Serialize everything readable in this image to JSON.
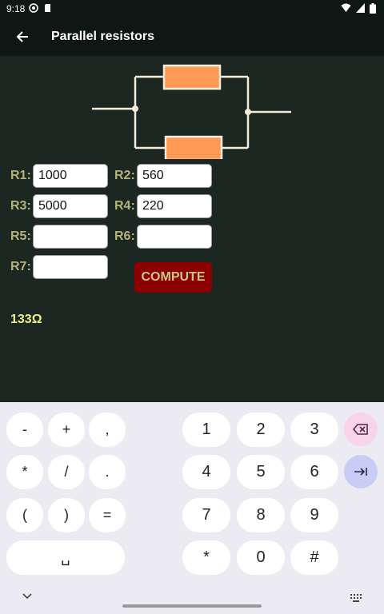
{
  "status": {
    "time": "9:18"
  },
  "app_bar": {
    "title": "Parallel resistors"
  },
  "form": {
    "r1": {
      "label": "R1:",
      "value": "1000"
    },
    "r2": {
      "label": "R2:",
      "value": "560"
    },
    "r3": {
      "label": "R3:",
      "value": "5000"
    },
    "r4": {
      "label": "R4:",
      "value": "220"
    },
    "r5": {
      "label": "R5:",
      "value": ""
    },
    "r6": {
      "label": "R6:",
      "value": ""
    },
    "r7": {
      "label": "R7:",
      "value": ""
    },
    "compute_label": "COMPUTE",
    "result": "133Ω"
  },
  "keyboard": {
    "sym": [
      "-",
      "+",
      ",",
      "*",
      "/",
      ".",
      "(",
      ")",
      "=",
      "␣"
    ],
    "num": [
      "1",
      "2",
      "3",
      "4",
      "5",
      "6",
      "7",
      "8",
      "9",
      "*",
      "0",
      "#"
    ]
  },
  "colors": {
    "background": "#1c2721",
    "bar": "#0e1714",
    "resistor": "#ff9955",
    "compute": "#8b0000",
    "label": "#b3b37a",
    "result": "#efef8e"
  }
}
